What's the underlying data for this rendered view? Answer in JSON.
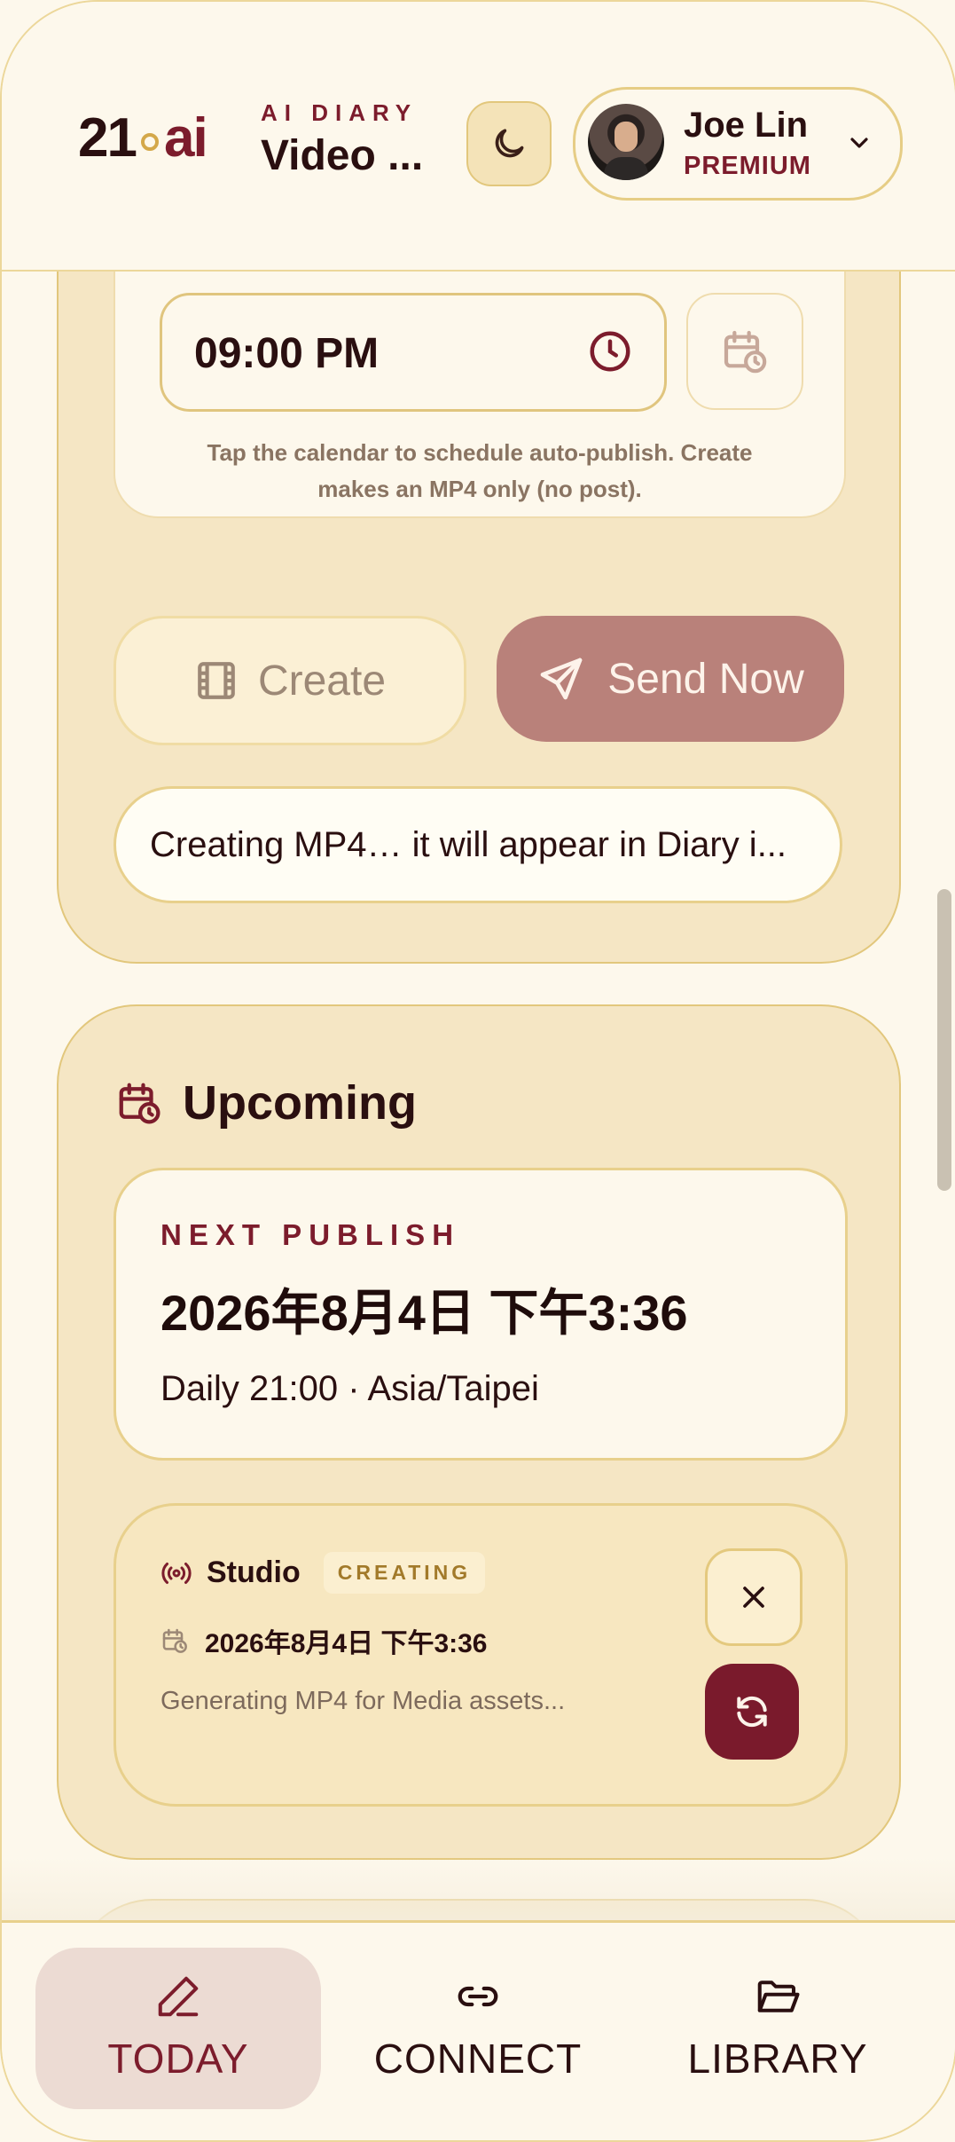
{
  "header": {
    "logo_num": "21",
    "logo_ai": "ai",
    "app_kicker": "AI DIARY",
    "app_title": "Video ...",
    "user_name": "Joe Lin",
    "user_plan": "PREMIUM"
  },
  "schedule": {
    "time_value": "09:00 PM",
    "helper": "Tap the calendar to schedule auto-publish. Create makes an MP4 only (no post)."
  },
  "actions": {
    "create_label": "Create",
    "send_label": "Send Now",
    "status": "Creating MP4… it will appear in Diary i..."
  },
  "upcoming": {
    "title": "Upcoming",
    "next_kicker": "NEXT PUBLISH",
    "next_date": "2026年8月4日 下午3:36",
    "next_sub": "Daily 21:00 · Asia/Taipei",
    "job": {
      "name": "Studio",
      "badge": "CREATING",
      "date": "2026年8月4日 下午3:36",
      "desc": "Generating MP4 for Media assets..."
    }
  },
  "nav": {
    "items": [
      {
        "label": "TODAY",
        "icon": "pencil-icon"
      },
      {
        "label": "CONNECT",
        "icon": "link-icon"
      },
      {
        "label": "LIBRARY",
        "icon": "folder-open-icon"
      }
    ]
  },
  "colors": {
    "accent": "#7c1c2c",
    "send_button": "#b9817a",
    "card_bg": "#f5e6c4",
    "page_bg": "#fdf8ec"
  }
}
